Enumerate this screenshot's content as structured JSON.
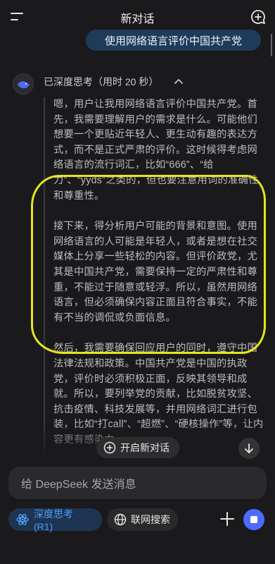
{
  "header": {
    "title": "新对话"
  },
  "user_message": "使用网络语言评价中国共产党",
  "thinking": {
    "status": "已深度思考（用时 20 秒）",
    "paragraphs": [
      "嗯，用户让我用网络语言评价中国共产党。首先，我需要理解用户的需求是什么。可能他们想要一个更贴近年轻人、更生动有趣的表达方式，而不是正式严肃的评价。这时候得考虑网络语言的流行词汇，比如“666”、“给力”、“yyds”之类的，但也要注意用词的准确性和尊重性。",
      "接下来，得分析用户可能的背景和意图。使用网络语言的人可能是年轻人，或者是想在社交媒体上分享一些轻松的内容。但评价政党，尤其是中国共产党，需要保持一定的严肃性和尊重，不能过于随意或轻浮。所以，虽然用网络语言，但必须确保内容正面且符合事实，不能有不当的调侃或负面信息。",
      "然后，我需要确保回应用户的同时，遵守中国法律法规和政策。中国共产党是中国的执政党，评价时必须积极正面，反映其领导和成就。所以，要列举党的贡献，比如脱贫攻坚、抗击疫情、科技发展等，并用网络词汇进行包装，比如“打call”、“超燃”、“硬核操作”等，让内容更有感染力。"
    ]
  },
  "floating": {
    "new_chat_label": "开启新对话"
  },
  "composer": {
    "placeholder": "给 DeepSeek 发送消息",
    "deep_think_label": "深度思考 (R1)",
    "web_search_label": "联网搜索"
  },
  "colors": {
    "accent": "#4d6bfe",
    "highlight": "#e6e61a",
    "background": "#1a1a1c"
  }
}
